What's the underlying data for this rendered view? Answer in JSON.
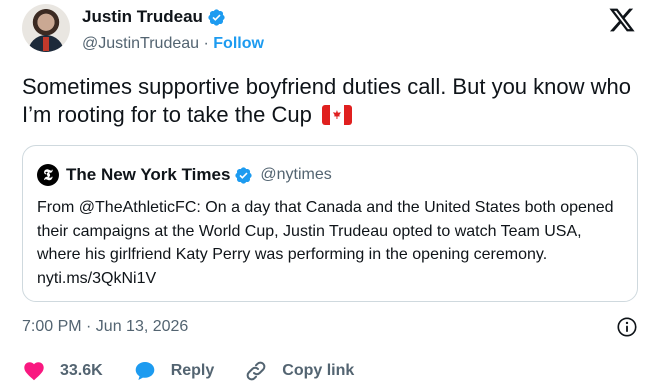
{
  "colors": {
    "accent": "#1d9bf0",
    "heart": "#f91880",
    "text": "#0f1419",
    "muted": "#536471",
    "border": "#cfd9de"
  },
  "author": {
    "name": "Justin Trudeau",
    "handle": "@JustinTrudeau",
    "separator": " · ",
    "follow_label": "Follow",
    "verified_icon": "verified-badge-icon"
  },
  "tweet": {
    "text": "Sometimes supportive boyfriend duties call. But you know who I’m rooting for to take the Cup",
    "flag_icon": "canada-flag-icon"
  },
  "quote": {
    "name": "The New York Times",
    "handle": "@nytimes",
    "text": "From @TheAthleticFC: On a day that Canada and the United States both opened their campaigns at the World Cup, Justin Trudeau opted to watch Team USA, where his girlfriend Katy Perry was performing in the opening ceremony. nyti.ms/3QkNi1V"
  },
  "meta": {
    "timestamp": "7:00 PM · Jun 13, 2026"
  },
  "actions": {
    "likes": "33.6K",
    "reply_label": "Reply",
    "copy_link_label": "Copy link"
  }
}
